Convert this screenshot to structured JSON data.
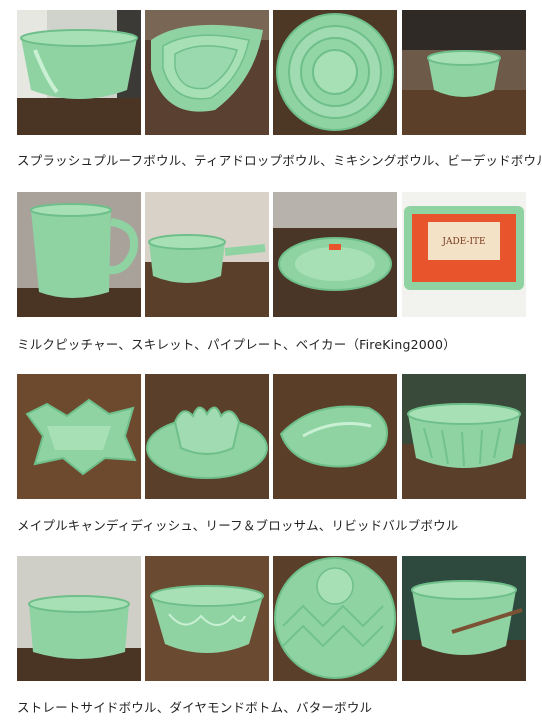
{
  "colors": {
    "jade": "#8fd3a3",
    "jade_dark": "#63b582",
    "jade_light": "#b9e8c5",
    "wood_dark": "#3a2a1d",
    "wood_mid": "#6b4a2f",
    "wall": "#d9d5cf",
    "accent_box": "#e8542b"
  },
  "rows": [
    {
      "caption": "スプラッシュプルーフボウル、ティアドロップボウル、ミキシングボウル、ビーデッドボウル",
      "photos": [
        {
          "icon": "splashproof-bowl-photo"
        },
        {
          "icon": "teardrop-bowl-photo"
        },
        {
          "icon": "mixing-bowl-photo"
        },
        {
          "icon": "beaded-bowl-photo"
        }
      ]
    },
    {
      "caption": "ミルクピッチャー、スキレット、パイプレート、ベイカー（FireKing2000）",
      "photos": [
        {
          "icon": "milk-pitcher-photo"
        },
        {
          "icon": "skillet-photo"
        },
        {
          "icon": "pie-plate-photo"
        },
        {
          "icon": "baker-box-photo",
          "box_text": "JADE-ITE"
        }
      ]
    },
    {
      "caption": "メイプルキャンディディッシュ、リーフ＆ブロッサム、リビッドバルブボウル",
      "photos": [
        {
          "icon": "maple-candy-dish-photo"
        },
        {
          "icon": "leaf-blossom-photo"
        },
        {
          "icon": "leaf-dish-photo"
        },
        {
          "icon": "swirl-bowl-photo"
        }
      ]
    },
    {
      "caption": "ストレートサイドボウル、ダイヤモンドボトム、バターボウル",
      "photos": [
        {
          "icon": "straight-side-bowl-photo"
        },
        {
          "icon": "diamond-bottom-photo"
        },
        {
          "icon": "swirl-bowl-photo-2"
        },
        {
          "icon": "batter-bowl-photo"
        }
      ]
    }
  ]
}
